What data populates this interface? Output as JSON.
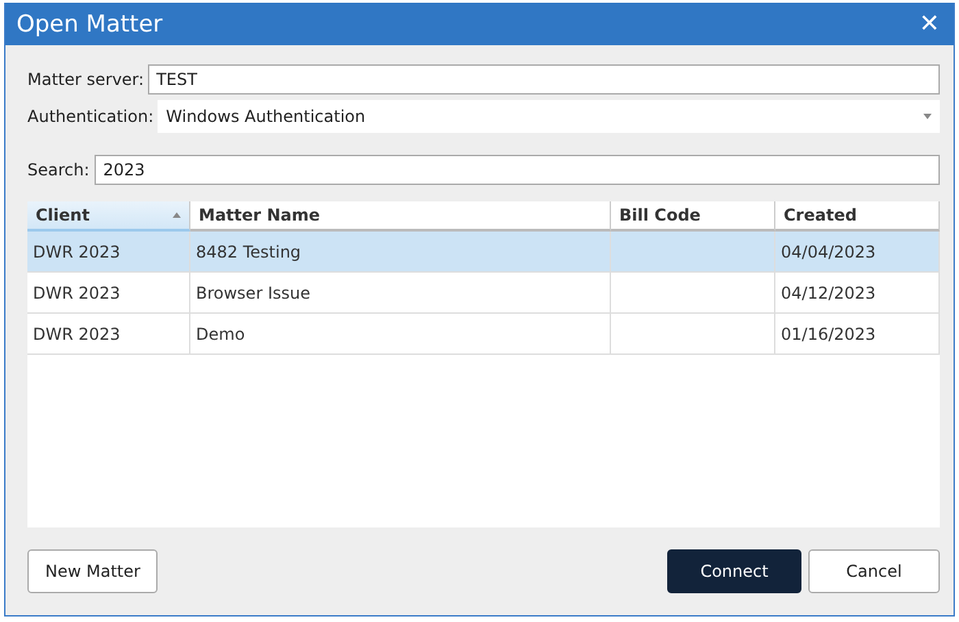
{
  "window": {
    "title": "Open Matter",
    "close": "✕"
  },
  "form": {
    "server_label": "Matter server:",
    "server": "TEST",
    "auth_label": "Authentication:",
    "auth": "Windows Authentication",
    "search_label": "Search:",
    "search": "2023"
  },
  "table": {
    "columns": [
      {
        "label": "Client",
        "sorted": true
      },
      {
        "label": "Matter Name",
        "sorted": false
      },
      {
        "label": "Bill Code",
        "sorted": false
      },
      {
        "label": "Created",
        "sorted": false
      }
    ],
    "rows": [
      {
        "cells": [
          "DWR 2023",
          "8482 Testing",
          "",
          "04/04/2023"
        ],
        "selected": true
      },
      {
        "cells": [
          "DWR 2023",
          "Browser Issue",
          "",
          "04/12/2023"
        ],
        "selected": false
      },
      {
        "cells": [
          "DWR 2023",
          "Demo",
          "",
          "01/16/2023"
        ],
        "selected": false
      }
    ]
  },
  "buttons": [
    {
      "label": "New Matter",
      "kind": "secondary"
    },
    {
      "label": "Connect",
      "kind": "primary"
    },
    {
      "label": "Cancel",
      "kind": "secondary"
    }
  ]
}
